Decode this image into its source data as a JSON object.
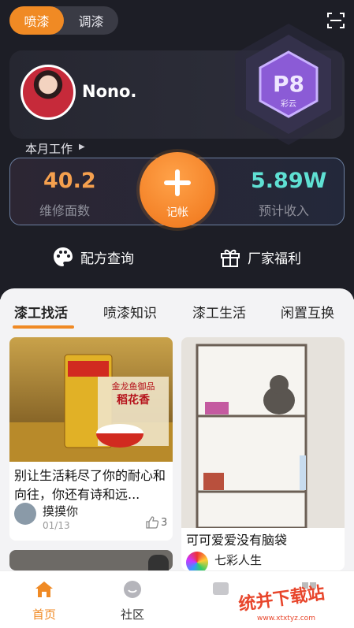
{
  "mode_tabs": [
    {
      "label": "喷漆",
      "active": true
    },
    {
      "label": "调漆",
      "active": false
    }
  ],
  "profile": {
    "name": "Nono.",
    "badge_level": "P8",
    "badge_label": "彩云"
  },
  "month_work": {
    "label": "本月工作",
    "repair_area": {
      "value": "40.2",
      "label": "维修面数"
    },
    "add_button": "记帐",
    "estimated_income": {
      "value": "5.89W",
      "label": "预计收入"
    }
  },
  "quick_actions": [
    {
      "label": "配方查询",
      "icon": "palette-icon"
    },
    {
      "label": "厂家福利",
      "icon": "gift-icon"
    }
  ],
  "category_tabs": [
    {
      "label": "漆工找活",
      "active": true
    },
    {
      "label": "喷漆知识",
      "active": false
    },
    {
      "label": "漆工生活",
      "active": false
    },
    {
      "label": "闲置互换",
      "active": false
    }
  ],
  "feed": [
    {
      "title": "别让生活耗尽了你的耐心和向往，你还有诗和远...",
      "author": "摸摸你",
      "date": "01/13",
      "likes": "3",
      "image_text": [
        "金龙鱼御品",
        "稻花香"
      ]
    },
    {
      "title": "可可爱爱没有脑袋",
      "author": "七彩人生"
    }
  ],
  "bottom_nav": [
    {
      "label": "首页",
      "icon": "home-icon",
      "active": true
    },
    {
      "label": "社区",
      "icon": "community-icon",
      "active": false
    },
    {
      "label": "",
      "icon": "message-icon",
      "active": false
    },
    {
      "label": "",
      "icon": "profile-icon",
      "active": false
    }
  ],
  "watermark": {
    "text": "统并下载站",
    "url": "www.xtxtyz.com"
  },
  "colors": {
    "accent": "#f08a24",
    "dark_bg": "#1d1e26",
    "repair_value": "#f5a04e",
    "income_value": "#5fe0d3",
    "badge": "#8b5bd6"
  }
}
